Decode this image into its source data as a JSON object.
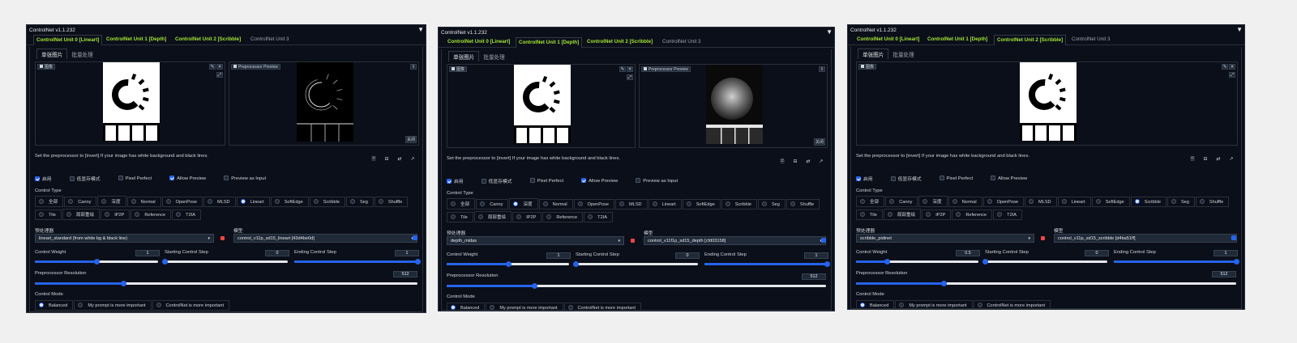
{
  "panels": [
    {
      "title": "ControlNet v1.1.232",
      "collapse_icon": "triangle-down-icon",
      "unit_tabs": [
        "ControlNet Unit 0 [Lineart]",
        "ControlNet Unit 1 [Depth]",
        "ControlNet Unit 2 [Scribble]",
        "ControlNet Unit 3"
      ],
      "selected_unit": 0,
      "image_tabs": [
        "单张图片",
        "批量处理"
      ],
      "image_label": "图像",
      "preview_label": "Preprocessor Preview",
      "preview_close": "关闭",
      "preview_type": "lineart",
      "hint": "Set the preprocessor to [invert] If your image has white background and black lines.",
      "checkboxes": [
        {
          "label": "启用",
          "checked": true
        },
        {
          "label": "低显存模式",
          "checked": false
        },
        {
          "label": "Pixel Perfect",
          "checked": false
        },
        {
          "label": "Allow Preview",
          "checked": true
        },
        {
          "label": "Preview as Input",
          "checked": false
        }
      ],
      "control_type_label": "Control Type",
      "control_types": [
        "全部",
        "Canny",
        "深度",
        "Normal",
        "OpenPose",
        "MLSD",
        "Lineart",
        "SoftEdge",
        "Scribble",
        "Seg",
        "Shuffle",
        "Tile",
        "局部重绘",
        "IP2P",
        "Reference",
        "T2IA"
      ],
      "control_type_selected": "Lineart",
      "preprocessor_label": "预处理器",
      "preprocessor_value": "lineart_standard (from white bg & black line)",
      "model_label": "模型",
      "model_value": "control_v11p_sd15_lineart [43d4be0d]",
      "weight_label": "Control Weight",
      "weight_value": "1",
      "weight_fraction": 0.5,
      "start_label": "Starting Control Step",
      "start_value": "0",
      "start_fraction": 0.0,
      "end_label": "Ending Control Step",
      "end_value": "1",
      "end_fraction": 1.0,
      "resolution_label": "Preprocessor Resolution",
      "resolution_value": "512",
      "resolution_fraction": 0.23,
      "mode_label": "Control Mode",
      "modes": [
        "Balanced",
        "My prompt is more important",
        "ControlNet is more important"
      ],
      "mode_selected": "Balanced"
    },
    {
      "title": "ControlNet v1.1.232",
      "collapse_icon": "triangle-down-icon",
      "unit_tabs": [
        "ControlNet Unit 0 [Lineart]",
        "ControlNet Unit 1 [Depth]",
        "ControlNet Unit 2 [Scribble]",
        "ControlNet Unit 3"
      ],
      "selected_unit": 1,
      "image_tabs": [
        "单张图片",
        "批量处理"
      ],
      "image_label": "图像",
      "preview_label": "Preprocessor Preview",
      "preview_close": "关闭",
      "preview_type": "depth",
      "hint": "Set the preprocessor to [invert] If your image has white background and black lines.",
      "checkboxes": [
        {
          "label": "启用",
          "checked": true
        },
        {
          "label": "低显存模式",
          "checked": false
        },
        {
          "label": "Pixel Perfect",
          "checked": false
        },
        {
          "label": "Allow Preview",
          "checked": true
        },
        {
          "label": "Preview as Input",
          "checked": false
        }
      ],
      "control_type_label": "Control Type",
      "control_types": [
        "全部",
        "Canny",
        "深度",
        "Normal",
        "OpenPose",
        "MLSD",
        "Lineart",
        "SoftEdge",
        "Scribble",
        "Seg",
        "Shuffle",
        "Tile",
        "局部重绘",
        "IP2P",
        "Reference",
        "T2IA"
      ],
      "control_type_selected": "深度",
      "preprocessor_label": "预处理器",
      "preprocessor_value": "depth_midas",
      "model_label": "模型",
      "model_value": "control_v11f1p_sd15_depth [cfd03158]",
      "weight_label": "Control Weight",
      "weight_value": "1",
      "weight_fraction": 0.5,
      "start_label": "Starting Control Step",
      "start_value": "0",
      "start_fraction": 0.0,
      "end_label": "Ending Control Step",
      "end_value": "1",
      "end_fraction": 1.0,
      "resolution_label": "Preprocessor Resolution",
      "resolution_value": "512",
      "resolution_fraction": 0.23,
      "mode_label": "Control Mode",
      "modes": [
        "Balanced",
        "My prompt is more important",
        "ControlNet is more important"
      ],
      "mode_selected": "Balanced"
    },
    {
      "title": "ControlNet v1.1.232",
      "collapse_icon": "triangle-down-icon",
      "unit_tabs": [
        "ControlNet Unit 0 [Lineart]",
        "ControlNet Unit 1 [Depth]",
        "ControlNet Unit 2 [Scribble]",
        "ControlNet Unit 3"
      ],
      "selected_unit": 2,
      "image_tabs": [
        "单张图片",
        "批量处理"
      ],
      "image_label": "图像",
      "preview_label": "",
      "preview_close": "",
      "preview_type": "none",
      "hint": "Set the preprocessor to [invert] If your image has white background and black lines.",
      "checkboxes": [
        {
          "label": "启用",
          "checked": true
        },
        {
          "label": "低显存模式",
          "checked": false
        },
        {
          "label": "Pixel Perfect",
          "checked": false
        },
        {
          "label": "Allow Preview",
          "checked": false
        }
      ],
      "control_type_label": "Control Type",
      "control_types": [
        "全部",
        "Canny",
        "深度",
        "Normal",
        "OpenPose",
        "MLSD",
        "Lineart",
        "SoftEdge",
        "Scribble",
        "Seg",
        "Shuffle",
        "Tile",
        "局部重绘",
        "IP2P",
        "Reference",
        "T2IA"
      ],
      "control_type_selected": "Scribble",
      "preprocessor_label": "预处理器",
      "preprocessor_value": "scribble_pidinet",
      "model_label": "模型",
      "model_value": "control_v11p_sd15_scribble [d4ba51ff]",
      "weight_label": "Control Weight",
      "weight_value": "0.5",
      "weight_fraction": 0.25,
      "start_label": "Starting Control Step",
      "start_value": "0",
      "start_fraction": 0.0,
      "end_label": "Ending Control Step",
      "end_value": "1",
      "end_fraction": 1.0,
      "resolution_label": "Preprocessor Resolution",
      "resolution_value": "512",
      "resolution_fraction": 0.23,
      "mode_label": "Control Mode",
      "modes": [
        "Balanced",
        "My prompt is more important",
        "ControlNet is more important"
      ],
      "mode_selected": "Balanced"
    }
  ],
  "colors": {
    "accent": "#2563eb",
    "active_tab": "#a3e635",
    "background": "#0b0f19"
  },
  "icons": {
    "image_tools": [
      "brush-icon",
      "close-icon",
      "pen-icon"
    ],
    "tool_row": [
      "document-icon",
      "camera-icon",
      "swap-icon",
      "arrow-up-right-icon"
    ]
  }
}
